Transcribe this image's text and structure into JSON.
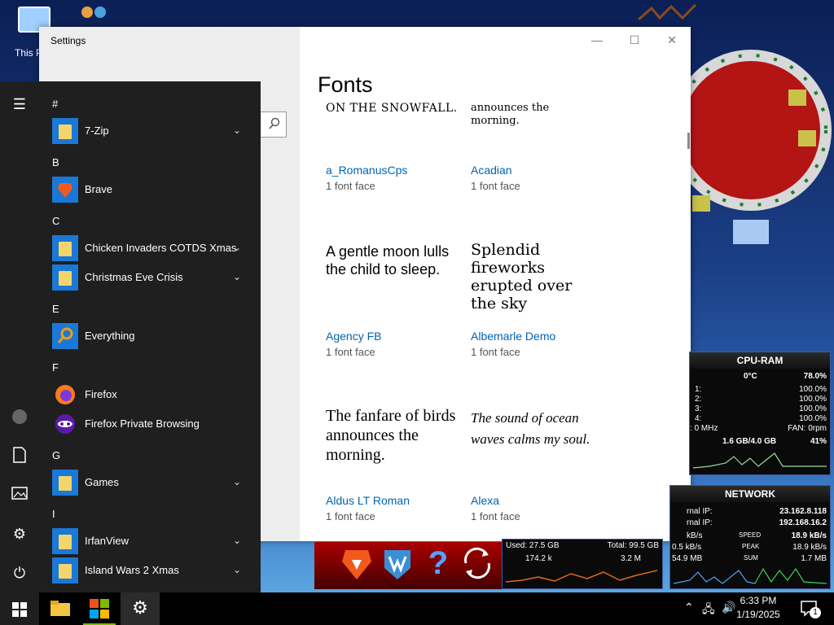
{
  "desktop": {
    "this_pc_label": "This P"
  },
  "settings": {
    "window_title": "Settings",
    "page_title": "Fonts",
    "controls": {
      "minimize": "—",
      "maximize": "☐",
      "close": "✕"
    },
    "fonts": [
      {
        "sample": "ON THE SNOWFALL.",
        "name": "a_RomanusCps",
        "faces": "1 font face"
      },
      {
        "sample": "announces the morning.",
        "name": "Acadian",
        "faces": "1 font face"
      },
      {
        "sample": "A gentle moon lulls the child to sleep.",
        "name": "Agency FB",
        "faces": "1 font face"
      },
      {
        "sample": "Splendid fireworks erupted over the sky",
        "name": "Albemarle Demo",
        "faces": "1 font face"
      },
      {
        "sample": "The fanfare of birds announces the morning.",
        "name": "Aldus LT Roman",
        "faces": "1 font face"
      },
      {
        "sample": "The sound of ocean waves calms my soul.",
        "name": "Alexa",
        "faces": "1 font face"
      }
    ]
  },
  "start_menu": {
    "groups": [
      {
        "letter": "#",
        "apps": [
          {
            "label": "7-Zip",
            "icon": "folder-icon",
            "expandable": true
          }
        ]
      },
      {
        "letter": "B",
        "apps": [
          {
            "label": "Brave",
            "icon": "brave-icon",
            "expandable": false
          }
        ]
      },
      {
        "letter": "C",
        "apps": [
          {
            "label": "Chicken Invaders COTDS Xmas",
            "icon": "folder-icon",
            "expandable": true
          },
          {
            "label": "Christmas Eve Crisis",
            "icon": "folder-icon",
            "expandable": true
          }
        ]
      },
      {
        "letter": "E",
        "apps": [
          {
            "label": "Everything",
            "icon": "search-icon",
            "expandable": false
          }
        ]
      },
      {
        "letter": "F",
        "apps": [
          {
            "label": "Firefox",
            "icon": "firefox-icon",
            "expandable": false
          },
          {
            "label": "Firefox Private Browsing",
            "icon": "firefox-private-icon",
            "expandable": false
          }
        ]
      },
      {
        "letter": "G",
        "apps": [
          {
            "label": "Games",
            "icon": "folder-icon",
            "expandable": true
          }
        ]
      },
      {
        "letter": "I",
        "apps": [
          {
            "label": "IrfanView",
            "icon": "folder-icon",
            "expandable": true
          },
          {
            "label": "Island Wars 2 Xmas",
            "icon": "folder-icon",
            "expandable": true
          }
        ]
      }
    ]
  },
  "gadgets": {
    "cpu_ram": {
      "title": "CPU-RAM",
      "temp": "0°C",
      "total": "78.0%",
      "cores": [
        {
          "label": "1:",
          "value": "100.0%"
        },
        {
          "label": "2:",
          "value": "100.0%"
        },
        {
          "label": "3:",
          "value": "100.0%"
        },
        {
          "label": "4:",
          "value": "100.0%"
        }
      ],
      "freq": ": 0 MHz",
      "fan": "FAN: 0rpm",
      "ram": "1.6 GB/4.0 GB",
      "ram_pct": "41%"
    },
    "network": {
      "title": "NETWORK",
      "ext_ip_label": "rnal IP:",
      "ext_ip": "23.162.8.118",
      "int_ip_label": "rnal IP:",
      "int_ip": "192.168.16.2",
      "speed_left": "kB/s",
      "speed_label": "SPEED",
      "speed_value": "18.9 kB/s",
      "peak_left": "0.5 kB/s",
      "peak_label": "PEAK",
      "peak_value": "18.9 kB/s",
      "sum_left": "54.9 MB",
      "sum_label": "SUM",
      "sum_value": "1.7 MB"
    },
    "disk": {
      "used": "Used: 27.5 GB",
      "total": "Total: 99.5 GB",
      "left_val": "174.2 k",
      "right_val": "3.2 M"
    }
  },
  "taskbar": {
    "time": "6:33 PM",
    "date": "1/19/2025",
    "notif_count": "1"
  },
  "colors": {
    "accent": "#0063b1",
    "tile": "#1a78d6",
    "startmenu_bg": "#1f1f1f"
  }
}
